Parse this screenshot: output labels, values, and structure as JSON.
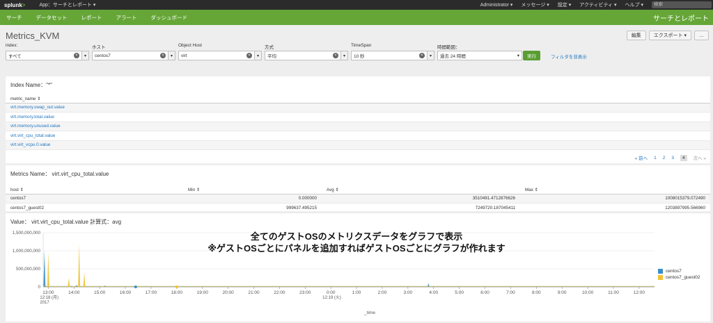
{
  "topbar": {
    "logo": "splunk",
    "logo_gt": ">",
    "app_menu": "App：サーチとレポート ▾",
    "items": [
      "Administrator ▾",
      "メッセージ ▾",
      "設定 ▾",
      "アクティビティ ▾",
      "ヘルプ ▾"
    ],
    "search_placeholder": "検索"
  },
  "appbar": {
    "nav": [
      "サーチ",
      "データセット",
      "レポート",
      "アラート",
      "ダッシュボード"
    ],
    "app_title": "サーチとレポート"
  },
  "page": {
    "title": "Metrics_KVM",
    "edit_label": "編集",
    "export_label": "エクスポート ▾",
    "more_label": "…"
  },
  "inputs": [
    {
      "label": "index:",
      "value": "すべて",
      "caret": "▾",
      "clear": "×"
    },
    {
      "label": "ホスト",
      "value": "centos7",
      "caret": "▾",
      "clear": "×"
    },
    {
      "label": "Object Host",
      "value": "virt",
      "caret": "▾",
      "clear": "×"
    },
    {
      "label": "方式",
      "value": "平均",
      "caret": "▾",
      "clear": "×"
    },
    {
      "label": "TimeSpan",
      "value": "10 秒",
      "caret": "▾",
      "clear": "×"
    }
  ],
  "time_input": {
    "label": "時間範囲：",
    "value": "過去 24 時間",
    "caret": "▾"
  },
  "submit_label": "実行",
  "hide_filters_label": "フィルタを非表示",
  "index_panel": {
    "title": "Index Name：\"*\"",
    "column": "metric_name ⇕",
    "rows": [
      "virt.memory.swap_out.value",
      "virt.memory.total.value",
      "virt.memory.unused.value",
      "virt.virt_cpu_total.value",
      "virt.virt_vcpu.0.value"
    ],
    "pager": {
      "prev": "« 前へ",
      "pages": [
        "1",
        "2",
        "3",
        "4"
      ],
      "current": "4",
      "next": "次へ »"
    }
  },
  "metrics_panel": {
    "title": "Metrics Name： virt.virt_cpu_total.value",
    "columns": [
      "host ⇕",
      "Min ⇕",
      "Avg ⇕",
      "Max ⇕"
    ],
    "rows": [
      [
        "centos7",
        "0.000000",
        "3510491.4712876626",
        "1008015379.072490"
      ],
      [
        "centos7_guest02",
        "999637.495215",
        "7249720.187045411",
        "1203897995.566960"
      ]
    ]
  },
  "chart_panel": {
    "title": "Value： virt.virt_cpu_total.value 計算式：avg",
    "overlay_line1": "全てのゲストOSのメトリクスデータをグラフで表示",
    "overlay_line2": "※ゲストOSごとにパネルを追加すればゲストOSごとにグラフが作れます"
  },
  "chart_data": {
    "type": "area",
    "xlabel": "_time",
    "ylabel": "",
    "ylim": [
      0,
      1500000000
    ],
    "y_ticks": [
      "1,500,000,000",
      "1,000,000,000",
      "500,000,000",
      "0"
    ],
    "y_tick_values": [
      1500000000,
      1000000000,
      500000000,
      0
    ],
    "x_ticks": [
      "13:00",
      "14:00",
      "15:00",
      "16:00",
      "17:00",
      "18:00",
      "19:00",
      "20:00",
      "21:00",
      "22:00",
      "23:00",
      "0:00",
      "1:00",
      "2:00",
      "3:00",
      "4:00",
      "5:00",
      "6:00",
      "7:00",
      "8:00",
      "9:00",
      "10:00",
      "11:00",
      "12:00"
    ],
    "x_tick_sub": {
      "0": [
        "12:18 (月)",
        "2017"
      ],
      "11": [
        "12:19 (火)"
      ]
    },
    "x_range_hours": [
      12.8,
      36.6
    ],
    "series": [
      {
        "name": "centos7",
        "color": "#3b8fc4",
        "points": [
          [
            12.85,
            1000000000
          ],
          [
            12.9,
            20000000
          ],
          [
            13.9,
            30000000
          ],
          [
            14.1,
            60000000
          ],
          [
            15.2,
            40000000
          ],
          [
            16.3,
            20000000
          ],
          [
            27.8,
            100000000
          ],
          [
            28.0,
            5000000
          ]
        ]
      },
      {
        "name": "centos7_guest02",
        "color": "#f1c232",
        "points": [
          [
            13.0,
            950000000
          ],
          [
            13.3,
            30000000
          ],
          [
            13.8,
            250000000
          ],
          [
            14.0,
            30000000
          ],
          [
            14.2,
            1200000000
          ],
          [
            14.4,
            400000000
          ],
          [
            14.6,
            30000000
          ],
          [
            15.1,
            30000000
          ],
          [
            16.6,
            25000000
          ],
          [
            18.0,
            20000000
          ]
        ]
      }
    ],
    "legend": "right"
  }
}
